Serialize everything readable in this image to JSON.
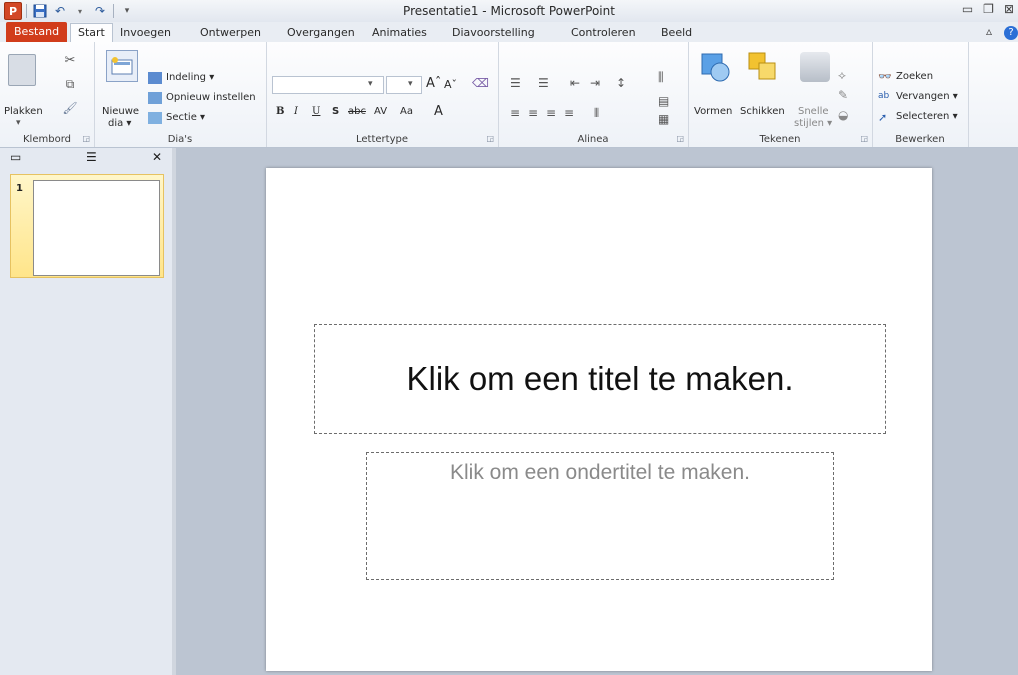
{
  "titlebar": {
    "title": "Presentatie1  -  Microsoft PowerPoint",
    "app_icon": "P",
    "qat": [
      "save-icon",
      "undo-icon",
      "redo-icon",
      "customize-icon"
    ]
  },
  "tabs": [
    "Bestand",
    "Start",
    "Invoegen",
    "Ontwerpen",
    "Overgangen",
    "Animaties",
    "Diavoorstelling",
    "Controleren",
    "Beeld"
  ],
  "ribbon": {
    "klembord": {
      "label": "Klembord",
      "paste": "Plakken"
    },
    "dias": {
      "label": "Dia's",
      "new_slide": "Nieuwe",
      "new_slide2": "dia ▾",
      "layout": "Indeling ▾",
      "reset": "Opnieuw instellen",
      "section": "Sectie ▾"
    },
    "lettertype": {
      "label": "Lettertype"
    },
    "alinea": {
      "label": "Alinea"
    },
    "tekenen": {
      "label": "Tekenen",
      "shapes": "Vormen",
      "arrange": "Schikken",
      "quick_styles": "Snelle",
      "quick_styles2": "stijlen ▾"
    },
    "bewerken": {
      "label": "Bewerken",
      "find": "Zoeken",
      "replace": "Vervangen ▾",
      "select": "Selecteren ▾"
    }
  },
  "leftpane": {
    "slide_number": "1"
  },
  "slide": {
    "title_placeholder": "Klik om een titel te maken.",
    "subtitle_placeholder": "Klik om een ondertitel te maken."
  },
  "colors": {
    "file_tab": "#d13c1b",
    "accent": "#2b6fd6"
  }
}
